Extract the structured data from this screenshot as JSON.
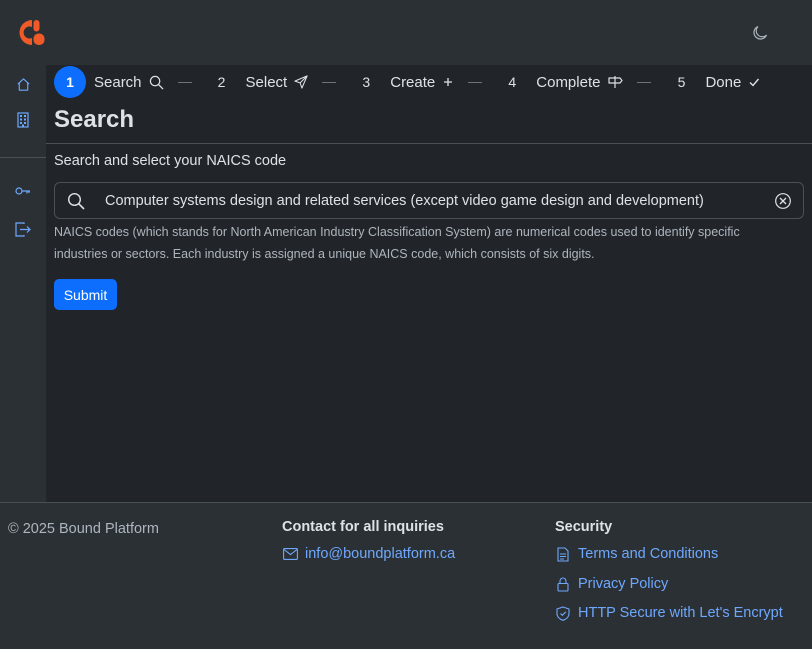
{
  "brand": {
    "logo_color": "#f05a28"
  },
  "colors": {
    "accent": "#0d6efd",
    "link": "#6ea8fe"
  },
  "sidebar": {
    "items": [
      {
        "icon": "home-icon"
      },
      {
        "icon": "building-icon"
      },
      {
        "icon": "key-icon"
      },
      {
        "icon": "logout-icon"
      }
    ]
  },
  "stepper": {
    "steps": [
      {
        "number": "1",
        "label": "Search",
        "icon": "search-icon",
        "active": true
      },
      {
        "number": "2",
        "label": "Select",
        "icon": "send-icon",
        "active": false
      },
      {
        "number": "3",
        "label": "Create",
        "icon": "plus-icon",
        "active": false
      },
      {
        "number": "4",
        "label": "Complete",
        "icon": "signpost-icon",
        "active": false
      },
      {
        "number": "5",
        "label": "Done",
        "icon": "check-icon",
        "active": false
      }
    ]
  },
  "main": {
    "title": "Search",
    "field_label": "Search and select your NAICS code",
    "search_value": "Computer systems design and related services (except video game design and development)",
    "help_text": "NAICS codes (which stands for North American Industry Classification System) are numerical codes used to identify specific industries or sectors. Each industry is assigned a unique NAICS code, which consists of six digits.",
    "submit_label": "Submit"
  },
  "footer": {
    "copyright": "© 2025 Bound Platform",
    "contact_heading": "Contact for all inquiries",
    "contact_email": "info@boundplatform.ca",
    "security_heading": "Security",
    "terms": "Terms and Conditions",
    "privacy": "Privacy Policy",
    "https": "HTTP Secure with Let's Encrypt"
  }
}
